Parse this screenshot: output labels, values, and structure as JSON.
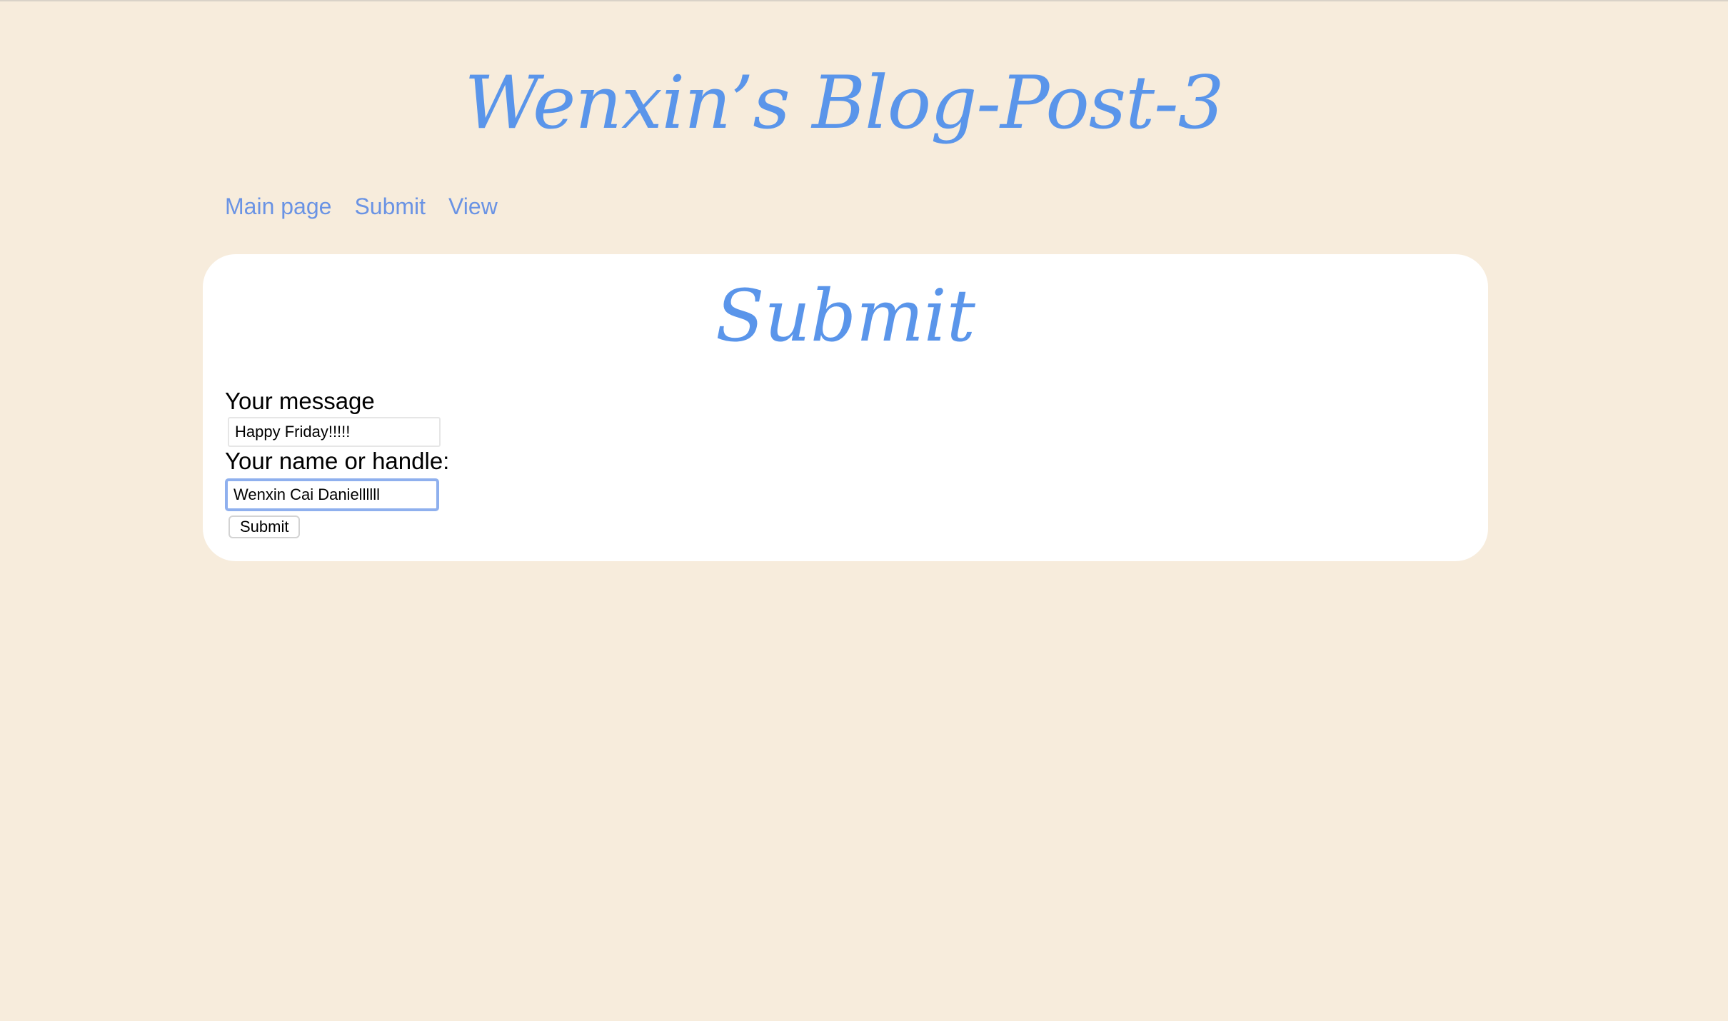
{
  "header": {
    "title": "Wenxin’s Blog-Post-3"
  },
  "nav": {
    "items": [
      {
        "label": "Main page"
      },
      {
        "label": "Submit"
      },
      {
        "label": "View"
      }
    ]
  },
  "main": {
    "title": "Submit",
    "form": {
      "message_label": "Your message",
      "message_value": "Happy Friday!!!!!",
      "name_label": "Your name or handle:",
      "name_value": "Wenxin Cai Daniellllll",
      "submit_label": "Submit"
    }
  },
  "colors": {
    "background": "#f7ecdc",
    "accent": "#5a95ea",
    "link": "#6a93e4",
    "card": "#ffffff",
    "focus_ring": "#8fb0ee"
  }
}
